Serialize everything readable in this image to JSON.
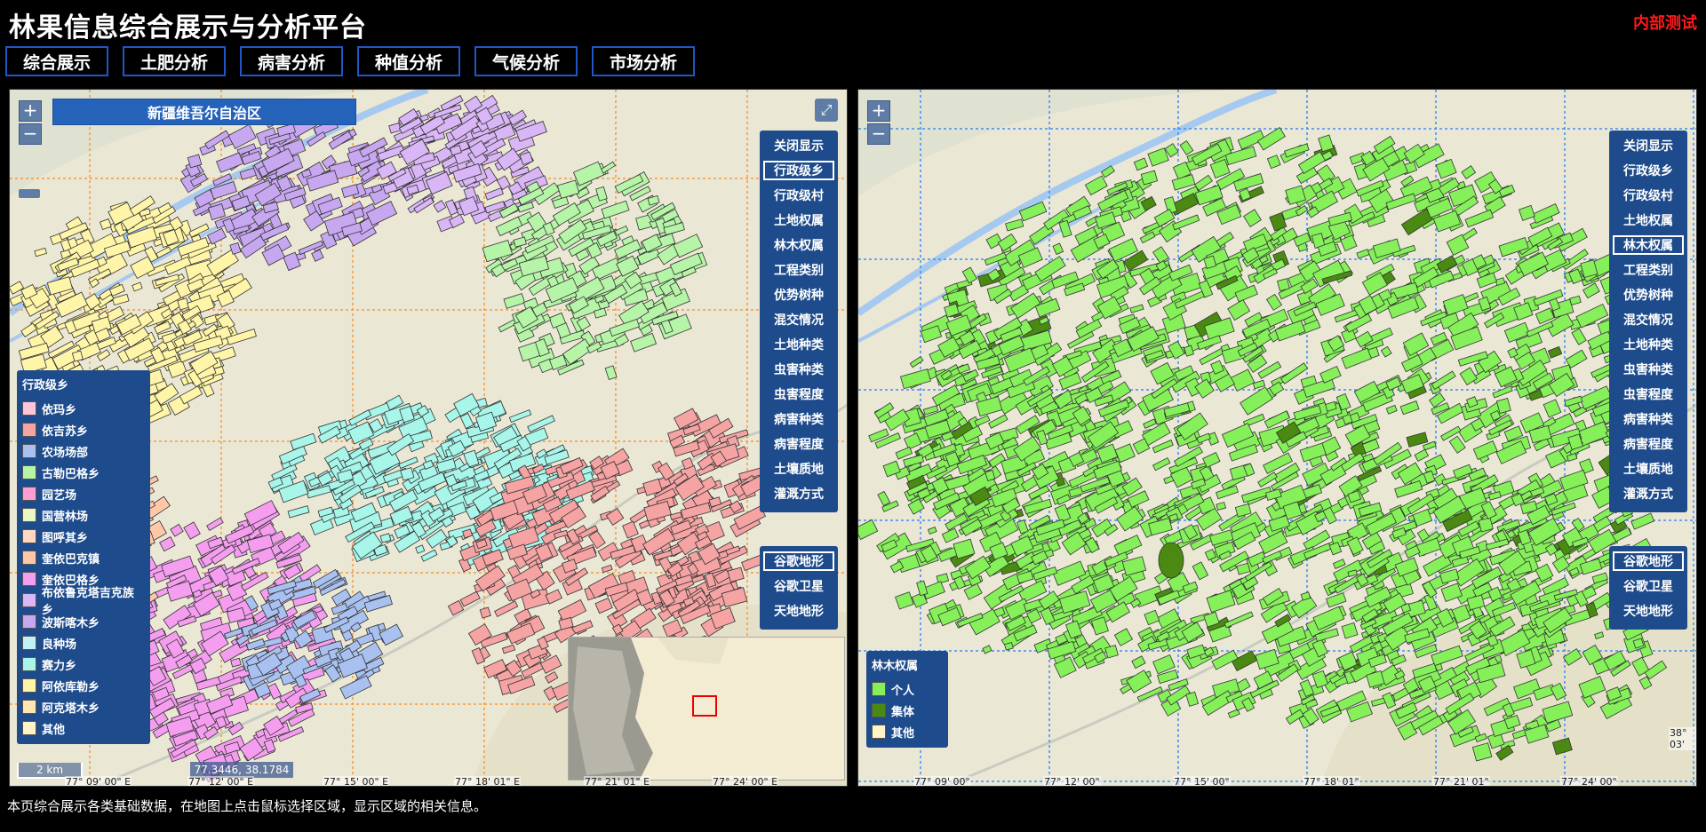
{
  "app": {
    "title": "林果信息综合展示与分析平台",
    "badge": "内部测试"
  },
  "nav": [
    "综合展示",
    "土肥分析",
    "病害分析",
    "种值分析",
    "气候分析",
    "市场分析"
  ],
  "colors": {
    "nav_border": "#1f57c7",
    "panel_bg": "#1d4b8c",
    "badge": "#ff1a1a"
  },
  "left_map": {
    "region_title": "新疆维吾尔自治区",
    "zoom_in": "+",
    "zoom_out": "−",
    "fullscreen_icon": "expand-icon",
    "layers": [
      "关闭显示",
      "行政级乡",
      "行政级村",
      "土地权属",
      "林木权属",
      "工程类别",
      "优势树种",
      "混交情况",
      "土地种类",
      "虫害种类",
      "虫害程度",
      "病害种类",
      "病害程度",
      "土壤质地",
      "灌溉方式"
    ],
    "active_layer": "行政级乡",
    "basemaps": [
      "谷歌地形",
      "谷歌卫星",
      "天地地形"
    ],
    "active_basemap": "谷歌地形",
    "legend": {
      "title": "行政级乡",
      "items": [
        {
          "label": "依玛乡",
          "color": "#ffc6d9"
        },
        {
          "label": "依吉苏乡",
          "color": "#f5a3a3"
        },
        {
          "label": "农场场部",
          "color": "#a9c1f0"
        },
        {
          "label": "古勒巴格乡",
          "color": "#b6f5a8"
        },
        {
          "label": "园艺场",
          "color": "#ff9ed2"
        },
        {
          "label": "国营林场",
          "color": "#e8f7c3"
        },
        {
          "label": "图呼其乡",
          "color": "#ffd7c2"
        },
        {
          "label": "奎依巴克镇",
          "color": "#ffc7a8"
        },
        {
          "label": "奎依巴格乡",
          "color": "#f59ef0"
        },
        {
          "label": "布依鲁克塔吉克族乡",
          "color": "#d9b6f5"
        },
        {
          "label": "波斯喀木乡",
          "color": "#c7a8f0"
        },
        {
          "label": "良种场",
          "color": "#c2f0f7"
        },
        {
          "label": "赛力乡",
          "color": "#a8f5ea"
        },
        {
          "label": "阿依库勒乡",
          "color": "#fff5a8"
        },
        {
          "label": "阿克塔木乡",
          "color": "#ffe6b3"
        },
        {
          "label": "其他",
          "color": "#fff3c7"
        }
      ]
    },
    "scale": "2 km",
    "coordinates": "77.3446, 38.1784",
    "lon_labels": [
      "77° 09' 00\" E",
      "77° 12' 00\" E",
      "77° 15' 00\" E",
      "77° 18' 01\" E",
      "77° 21' 01\" E",
      "77° 24' 00\" E"
    ]
  },
  "right_map": {
    "zoom_in": "+",
    "zoom_out": "−",
    "layers": [
      "关闭显示",
      "行政级乡",
      "行政级村",
      "土地权属",
      "林木权属",
      "工程类别",
      "优势树种",
      "混交情况",
      "土地种类",
      "虫害种类",
      "虫害程度",
      "病害种类",
      "病害程度",
      "土壤质地",
      "灌溉方式"
    ],
    "active_layer": "林木权属",
    "basemaps": [
      "谷歌地形",
      "谷歌卫星",
      "天地地形"
    ],
    "active_basemap": "谷歌地形",
    "legend": {
      "title": "林木权属",
      "items": [
        {
          "label": "个人",
          "color": "#86f05a"
        },
        {
          "label": "集体",
          "color": "#4a8a12"
        },
        {
          "label": "其他",
          "color": "#fff3c7"
        }
      ]
    },
    "lon_labels": [
      "77° 09' 00\"",
      "77° 12' 00\"",
      "77° 15' 00\"",
      "77° 18' 01\"",
      "77° 21' 01\"",
      "77° 24' 00\""
    ],
    "lat_label": "38° 03'"
  },
  "footer": "本页综合展示各类基础数据，在地图上点击鼠标选择区域，显示区域的相关信息。"
}
